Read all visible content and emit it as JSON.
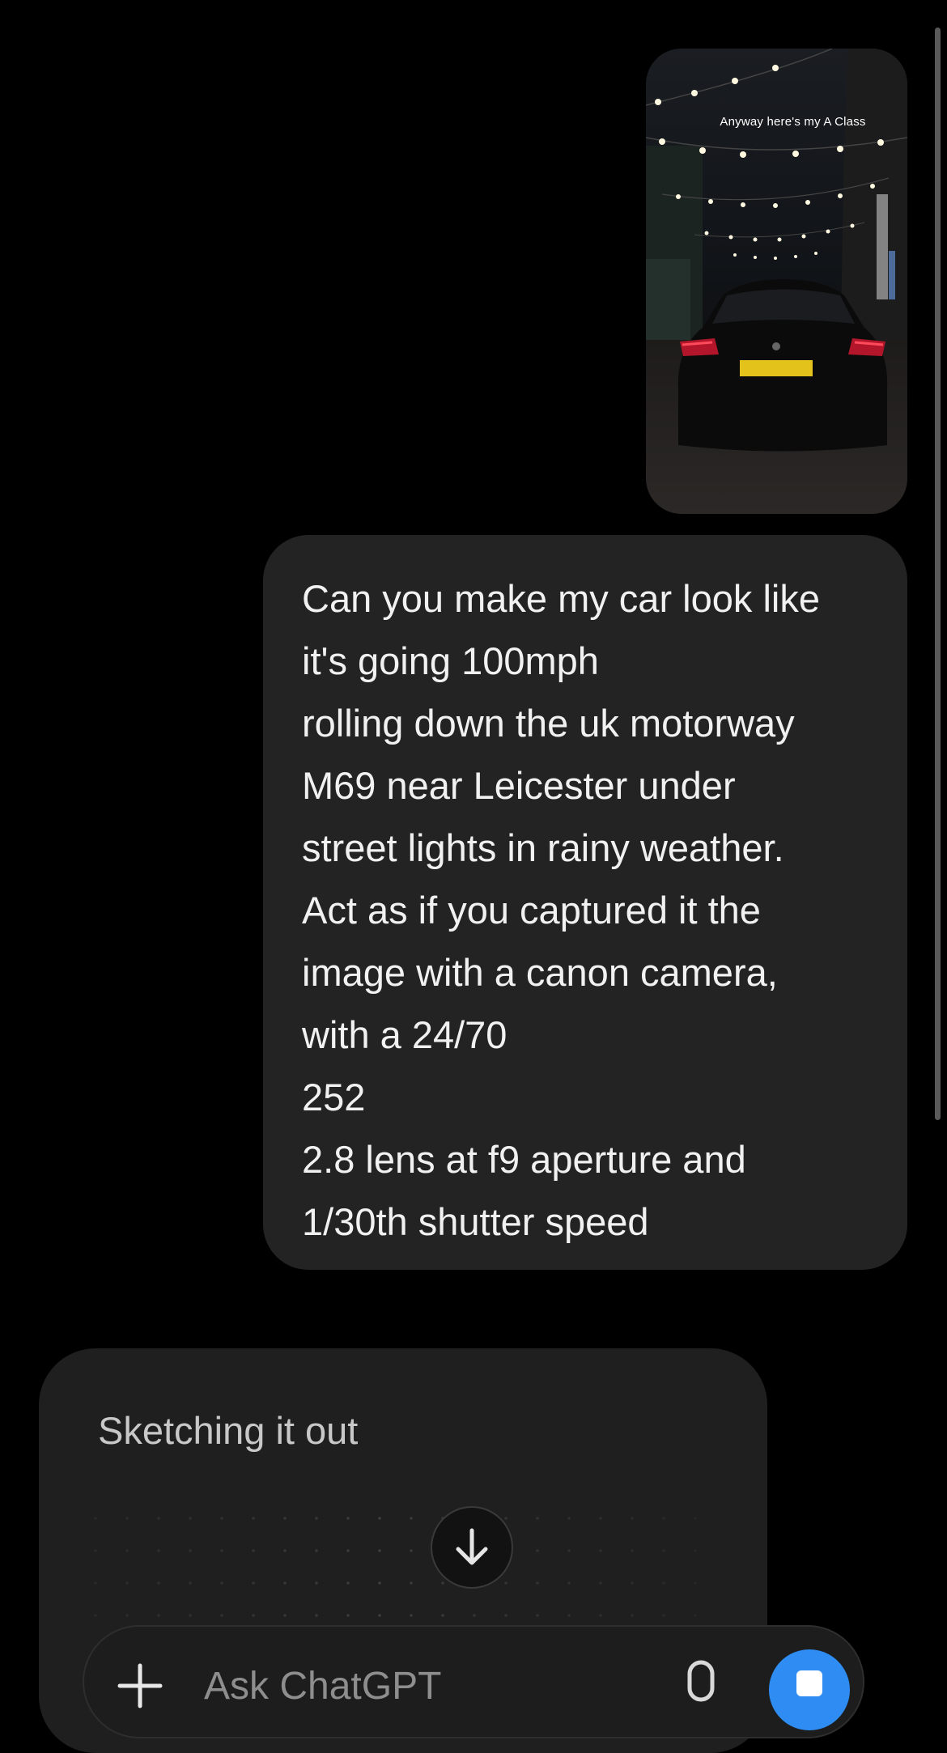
{
  "photo": {
    "caption": "Anyway here's my A Class"
  },
  "user_message": {
    "lines": [
      "Can you make my car look like",
      "it's going 100mph",
      "rolling down the uk motorway",
      "M69 near Leicester under",
      "street lights in rainy weather.",
      "Act as if you captured it the",
      "image with a canon camera,",
      "with a 24/70",
      "252",
      "2.8 lens at f9 aperture and",
      "1/30th shutter speed"
    ]
  },
  "assistant": {
    "status": "Sketching it out"
  },
  "composer": {
    "placeholder": "Ask ChatGPT"
  },
  "icons": {
    "attach": "plus-icon",
    "voice": "mic-icon",
    "stop": "stop-icon",
    "scroll": "arrow-down-icon"
  },
  "colors": {
    "background": "#000000",
    "bubble": "#232323",
    "card": "#1f1f1f",
    "accent": "#2f8cf2"
  }
}
